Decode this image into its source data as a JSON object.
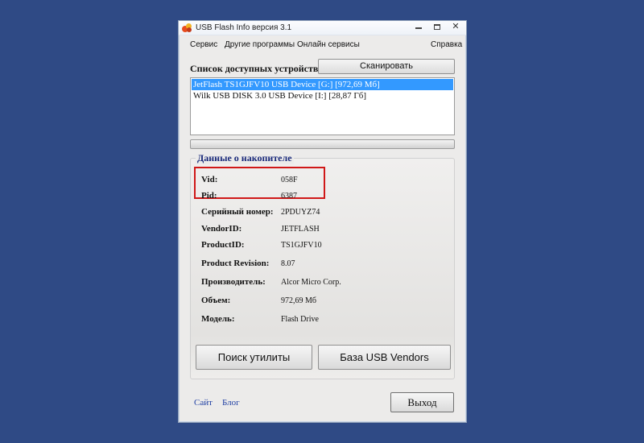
{
  "window": {
    "title": "USB Flash Info версия 3.1",
    "controls": {
      "minimize": "–",
      "maximize": "□",
      "close": "✕"
    }
  },
  "menu": [
    "Сервис",
    "Другие программы",
    "Онлайн сервисы",
    "Справка"
  ],
  "devices": {
    "label": "Список доступных устройств",
    "scan_button": "Сканировать",
    "items": [
      "JetFlash TS1GJFV10 USB Device  [G:] [972,69 Мб]",
      "Wilk USB DISK 3.0 USB Device  [I:] [28,87 Гб]"
    ],
    "selected_index": 0,
    "progress_fraction": 0
  },
  "info": {
    "title": "Данные о накопителе",
    "fields": [
      {
        "label": "Vid:",
        "value": "058F"
      },
      {
        "label": "Pid:",
        "value": "6387"
      },
      {
        "label": "Серийный номер:",
        "value": "2PDUYZ74"
      },
      {
        "label": "VendorID:",
        "value": "JETFLASH"
      },
      {
        "label": "ProductID:",
        "value": "TS1GJFV10"
      },
      {
        "label": "Product Revision:",
        "value": "8.07"
      },
      {
        "label": "Производитель:",
        "value": "Alcor Micro Corp."
      },
      {
        "label": "Объем:",
        "value": "972,69 Мб"
      },
      {
        "label": "Модель:",
        "value": "Flash Drive"
      }
    ],
    "buttons": {
      "search_utility": "Поиск утилиты",
      "usb_vendors": "База USB Vendors"
    }
  },
  "footer": {
    "site_link": "Сайт",
    "blog_link": "Блог",
    "exit_button": "Выход"
  },
  "colors": {
    "desktop": "#2f4a85",
    "selection": "#3399ff",
    "highlight_frame": "#d01818",
    "group_title": "#1a2a7a",
    "link": "#1f3fa3"
  },
  "icons": [
    "app-logo-icon",
    "minimize-icon",
    "maximize-icon",
    "close-icon"
  ]
}
